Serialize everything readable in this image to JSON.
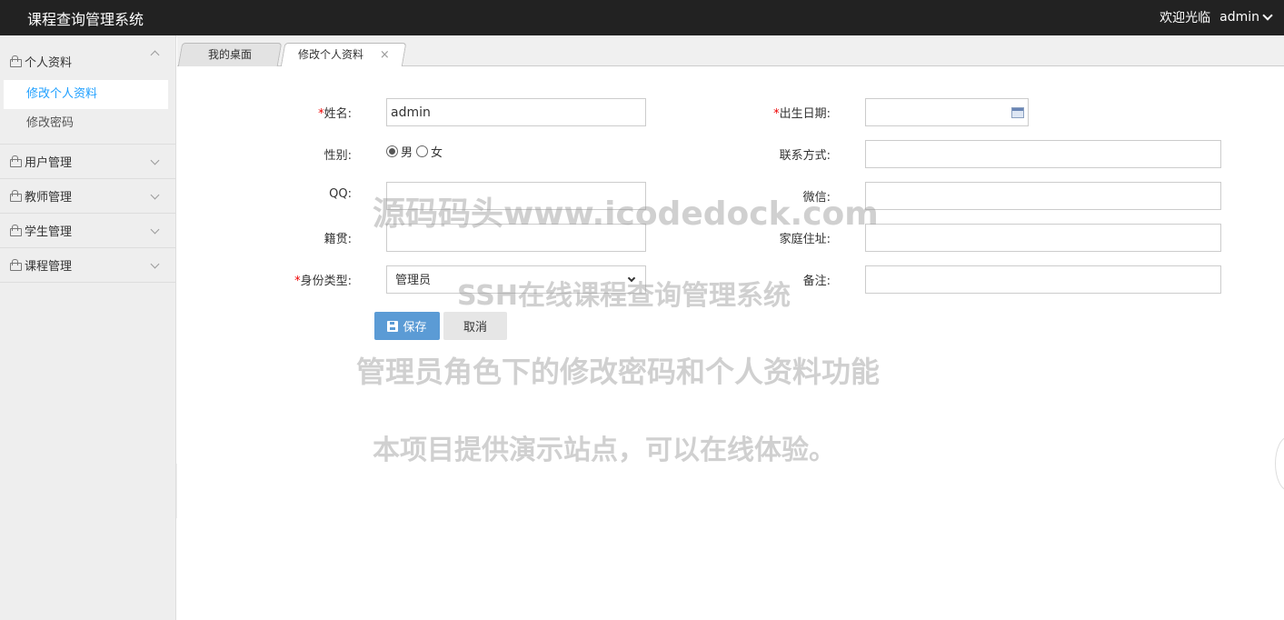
{
  "header": {
    "app_title": "课程查询管理系统",
    "welcome": "欢迎光临",
    "username": "admin"
  },
  "sidebar": {
    "groups": [
      {
        "label": "个人资料",
        "expanded": true,
        "items": [
          {
            "label": "修改个人资料",
            "active": true
          },
          {
            "label": "修改密码",
            "active": false
          }
        ]
      },
      {
        "label": "用户管理",
        "expanded": false
      },
      {
        "label": "教师管理",
        "expanded": false
      },
      {
        "label": "学生管理",
        "expanded": false
      },
      {
        "label": "课程管理",
        "expanded": false
      }
    ]
  },
  "tabs": [
    {
      "label": "我的桌面",
      "active": false
    },
    {
      "label": "修改个人资料",
      "active": true,
      "close": "×"
    }
  ],
  "form": {
    "required_mark": "*",
    "name_label": "姓名:",
    "name_value": "admin",
    "birth_label": "出生日期:",
    "birth_value": "",
    "gender_label": "性别:",
    "gender_male": "男",
    "gender_female": "女",
    "gender_selected": "男",
    "contact_label": "联系方式:",
    "qq_label": "QQ:",
    "wechat_label": "微信:",
    "origin_label": "籍贯:",
    "address_label": "家庭住址:",
    "identity_label": "身份类型:",
    "identity_value": "管理员",
    "remark_label": "备注:",
    "save_label": "保存",
    "cancel_label": "取消"
  },
  "watermark": {
    "line1": "源码码头www.icodedock.com",
    "line2": "SSH在线课程查询管理系统",
    "line3": "管理员角色下的修改密码和个人资料功能",
    "line4": "本项目提供演示站点，可以在线体验。"
  },
  "colors": {
    "topbar": "#222222",
    "accent": "#1e9fff",
    "save_button": "#5b9bd5",
    "required": "#ee0000"
  }
}
